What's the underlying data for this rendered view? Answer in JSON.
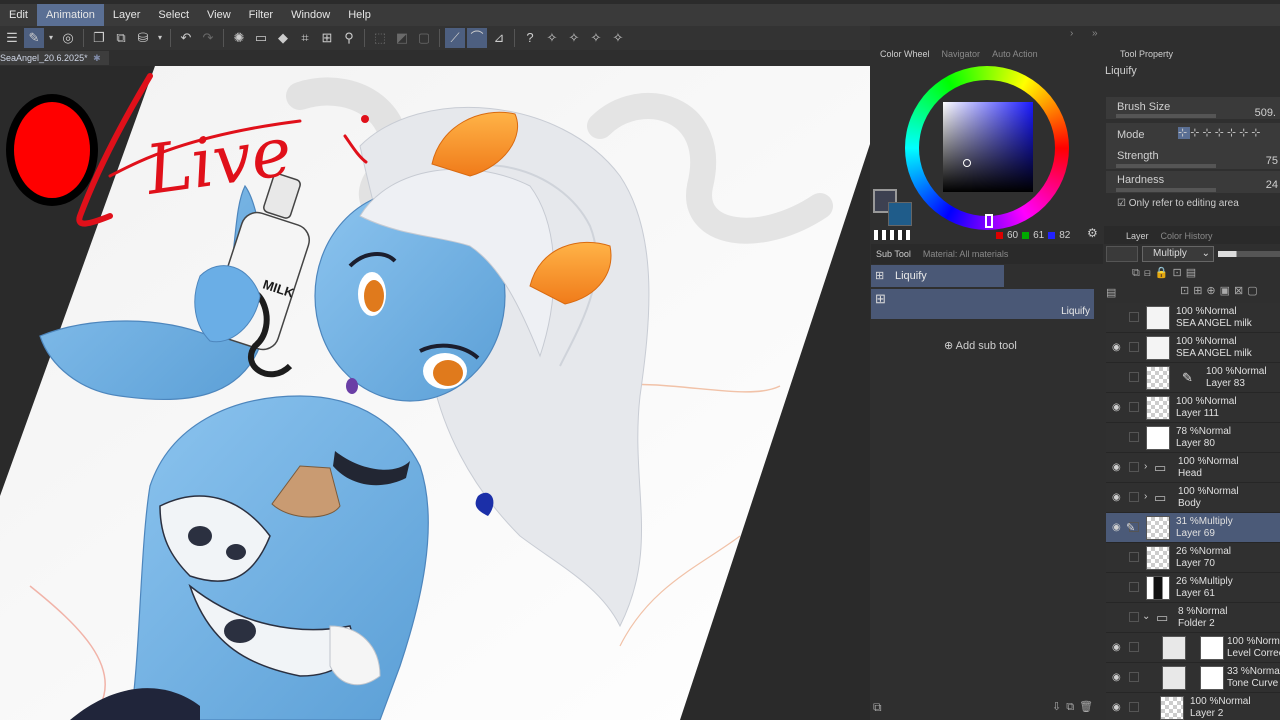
{
  "menu": [
    "Edit",
    "Animation",
    "Layer",
    "Select",
    "View",
    "Filter",
    "Window",
    "Help"
  ],
  "document_tab": "SeaAngel_20.6.2025*",
  "live_overlay": "Live",
  "milk_label": "MILK",
  "colors": {
    "accent": "#5a6f94",
    "main_color": "#3d4151",
    "sub_color": "#1f5c8a",
    "selected_layer": "#4b5a78"
  },
  "color_panel": {
    "tabs": [
      "Color Wheel",
      "Navigator",
      "Auto Action"
    ],
    "rgb": {
      "r": "60",
      "g": "61",
      "b": "82"
    }
  },
  "subtool": {
    "tabs": [
      "Sub Tool",
      "Material: All materials"
    ],
    "group": "Liquify",
    "item": "Liquify",
    "add_label": "Add sub tool"
  },
  "tool_property": {
    "tab": "Tool Property",
    "title": "Liquify",
    "brush_size_label": "Brush Size",
    "brush_size_value": "509.",
    "mode_label": "Mode",
    "strength_label": "Strength",
    "strength_value": "75",
    "hardness_label": "Hardness",
    "hardness_value": "24",
    "checkbox_label": "Only refer to editing area"
  },
  "layer_panel": {
    "tabs": [
      "Layer",
      "Color History"
    ],
    "blend_mode": "Multiply",
    "layers": [
      {
        "mode": "100 %Normal",
        "name": "SEA ANGEL milk",
        "visible": false,
        "kind": "text"
      },
      {
        "mode": "100 %Normal",
        "name": "SEA ANGEL milk",
        "visible": true,
        "kind": "text"
      },
      {
        "mode": "100 %Normal",
        "name": "Layer 83",
        "visible": false,
        "kind": "vector"
      },
      {
        "mode": "100 %Normal",
        "name": "Layer 111",
        "visible": true,
        "kind": "raster"
      },
      {
        "mode": "78 %Normal",
        "name": "Layer 80",
        "visible": false,
        "kind": "white"
      },
      {
        "mode": "100 %Normal",
        "name": "Head",
        "visible": true,
        "kind": "folder"
      },
      {
        "mode": "100 %Normal",
        "name": "Body",
        "visible": true,
        "kind": "folder"
      },
      {
        "mode": "31 %Multiply",
        "name": "Layer 69",
        "visible": true,
        "kind": "selected"
      },
      {
        "mode": "26 %Normal",
        "name": "Layer 70",
        "visible": false,
        "kind": "raster"
      },
      {
        "mode": "26 %Multiply",
        "name": "Layer 61",
        "visible": false,
        "kind": "dark"
      },
      {
        "mode": "8 %Normal",
        "name": "Folder 2",
        "visible": false,
        "kind": "openfolder"
      },
      {
        "mode": "100 %Norm",
        "name": "Level Correc",
        "visible": true,
        "kind": "adjust"
      },
      {
        "mode": "33 %Norma",
        "name": "Tone Curve",
        "visible": true,
        "kind": "adjust"
      },
      {
        "mode": "100 %Normal",
        "name": "Layer 2",
        "visible": true,
        "kind": "raster"
      }
    ]
  }
}
